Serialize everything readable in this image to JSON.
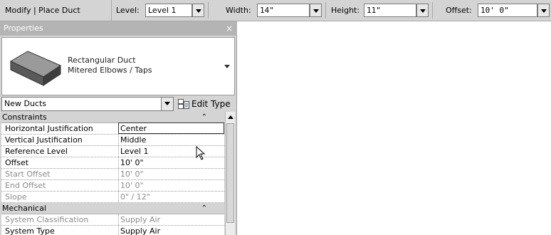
{
  "options_bar": {
    "mode": "Modify | Place Duct",
    "level_label": "Level:",
    "level_value": "Level 1",
    "width_label": "Width:",
    "width_value": "14\"",
    "height_label": "Height:",
    "height_value": "11\"",
    "offset_label": "Offset:",
    "offset_value": "10'  0\""
  },
  "properties": {
    "title": "Properties",
    "close_glyph": "×",
    "type_line1": "Rectangular Duct",
    "type_line2": "Mitered Elbows / Taps",
    "instance_filter": "New Ducts",
    "edit_type_label": "Edit Type",
    "rows": [
      {
        "group": true,
        "key": "Constraints",
        "chev": "⌃"
      },
      {
        "key": "Horizontal Justification",
        "value": "Center"
      },
      {
        "key": "Vertical Justification",
        "value": "Middle"
      },
      {
        "key": "Reference Level",
        "value": "Level 1"
      },
      {
        "key": "Offset",
        "value": "10'  0\""
      },
      {
        "key": "Start Offset",
        "value": "10'  0\"",
        "dim": true
      },
      {
        "key": "End Offset",
        "value": "10'  0\"",
        "dim": true
      },
      {
        "key": "Slope",
        "value": "0\" / 12\"",
        "dim": true
      },
      {
        "group": true,
        "key": "Mechanical",
        "chev": "⌃"
      },
      {
        "key": "System Classification",
        "value": "Supply Air",
        "dim": true
      },
      {
        "key": "System Type",
        "value": "Supply Air"
      }
    ]
  },
  "colors": {
    "panel_bg": "#d4d4d4",
    "title_bar": "#b4b4b4",
    "disabled_text": "#8c8c8c"
  },
  "icons": [
    "rectangular-duct-icon",
    "edit-type-icon",
    "dropdown-arrow-icon",
    "close-icon",
    "collapse-chevron-icon",
    "mouse-pointer-icon"
  ]
}
